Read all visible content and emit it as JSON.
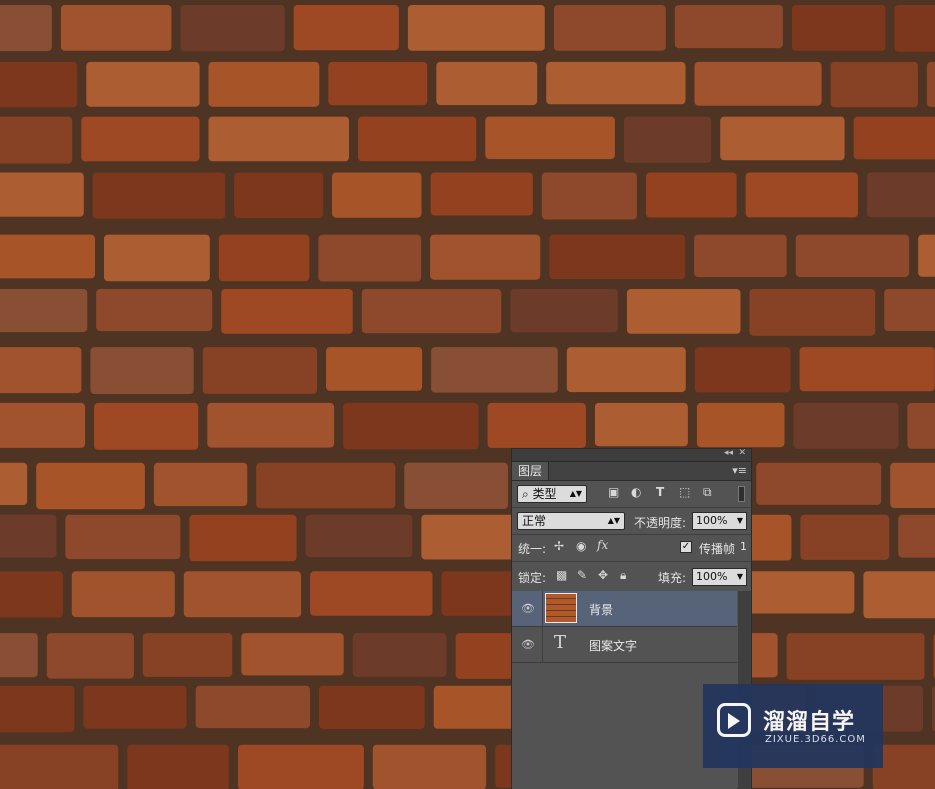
{
  "canvas": {
    "background_image": "brick-wall-photo"
  },
  "layers_panel": {
    "collapse_icon": "collapse-icon",
    "close_icon": "close-icon",
    "tab_label": "图层",
    "menu_icon": "panel-menu-icon",
    "filter_kind": "类型",
    "filter_icons": [
      "pixel-filter-icon",
      "adjustment-filter-icon",
      "type-filter-icon",
      "shape-filter-icon",
      "smart-object-filter-icon"
    ],
    "blend_mode": "正常",
    "opacity_label": "不透明度:",
    "opacity_value": "100%",
    "unify_label": "统一:",
    "propagate_label": "传播帧",
    "propagate_checked": true,
    "frame_number": "1",
    "lock_label": "锁定:",
    "fill_label": "填充:",
    "fill_value": "100%",
    "layers": [
      {
        "name": "背景",
        "kind": "image",
        "visible": true,
        "selected": true
      },
      {
        "name": "图案文字",
        "kind": "text",
        "visible": true,
        "selected": false
      }
    ],
    "selected_row_color": "#566379"
  },
  "watermark": {
    "brand": "溜溜自学",
    "url": "ZIXUE.3D66.COM",
    "color": "#23365d"
  }
}
